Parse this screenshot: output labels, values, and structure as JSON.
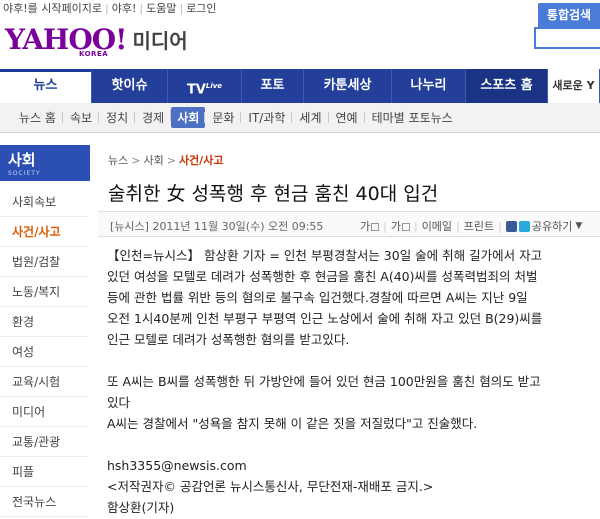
{
  "topbar": {
    "links": [
      "야후!를 시작페이지로",
      "야후!",
      "도움말",
      "로그인"
    ]
  },
  "logo": {
    "brand": "YAHOO!",
    "region": "KOREA",
    "section": "미디어"
  },
  "search": {
    "button_label": "통합검색",
    "placeholder": ""
  },
  "main_nav": [
    {
      "label": "뉴스",
      "active": true
    },
    {
      "label": "핫이슈"
    },
    {
      "label": "TV",
      "sup": "Live"
    },
    {
      "label": "포토"
    },
    {
      "label": "카툰세상"
    },
    {
      "label": "나누리"
    },
    {
      "label": "스포츠 홈"
    },
    {
      "label": "새로운 Y"
    }
  ],
  "sub_nav": [
    "뉴스 홈",
    "속보",
    "정치",
    "경제",
    "사회",
    "문화",
    "IT/과학",
    "세계",
    "연예",
    "테마별 포토뉴스"
  ],
  "sub_nav_active": "사회",
  "sidebar": {
    "title": "사회",
    "subtitle": "SOCIETY",
    "items": [
      "사회속보",
      "사건/사고",
      "법원/검찰",
      "노동/복지",
      "환경",
      "여성",
      "교육/시험",
      "미디어",
      "교통/관광",
      "피플",
      "전국뉴스"
    ],
    "active": "사건/사고"
  },
  "breadcrumb": [
    "뉴스",
    "사회",
    "사건/사고"
  ],
  "article": {
    "headline": "술취한 女 성폭행 후 현금 훔친 40대 입건",
    "meta": "[뉴시스]  2011년 11월 30일(수) 오전 09:55",
    "tools": {
      "font_up": "가",
      "font_down": "가",
      "email": "이메일",
      "print": "프린트",
      "share": "공유하기"
    },
    "lines": [
      "【인천=뉴시스】 함상환 기자 = 인천 부평경찰서는 30일 술에 취해 길가에서 자고",
      "있던 여성을 모텔로 데려가 성폭행한 후 현금을 훔친 A(40)씨를 성폭력범죄의 처벌",
      "등에 관한 법률 위반 등의 혐의로 불구속 입건했다.경찰에 따르면 A씨는 지난 9일",
      "오전 1시40분께 인천 부평구 부평역 인근 노상에서 술에 취해 자고 있던 B(29)씨를",
      "인근 모텔로 데려가 성폭행한 혐의를 받고있다.",
      "",
      "또 A씨는 B씨를 성폭행한 뒤 가방안에 들어 있던 현금 100만원을 훔친 혐의도 받고",
      "있다",
      "A씨는 경찰에서 \"성욕을 참지 못해 이 같은 짓을 저질렀다\"고 진술했다.",
      "",
      "hsh3355@newsis.com",
      "<저작권자© 공감언론 뉴시스통신사, 무단전재-재배포 금지.>",
      "함상환(기자)"
    ]
  },
  "colors": {
    "nav_blue": "#233f9a",
    "brand_purple": "#7b0099",
    "accent_orange": "#e05a00"
  }
}
